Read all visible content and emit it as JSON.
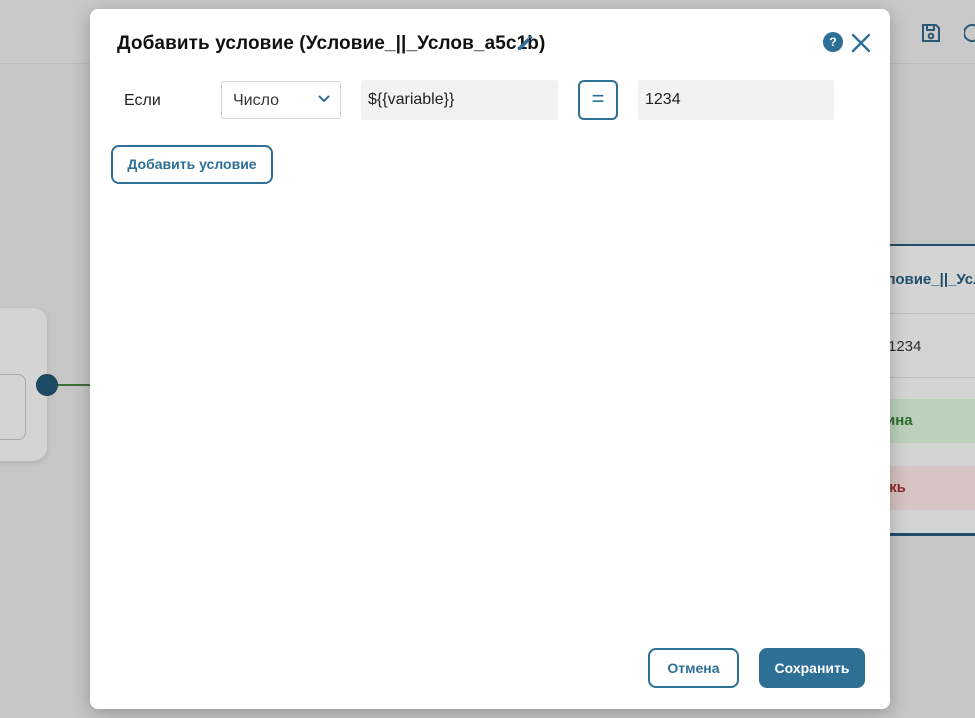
{
  "modal": {
    "title": "Добавить условие (Условие_||_Услов_a5c1b)",
    "help_label": "?",
    "condition": {
      "if_label": "Если",
      "type_value": "Число",
      "variable_value": "${{variable}}",
      "operator": "=",
      "compare_value": "1234"
    },
    "add_condition_label": "Добавить условие",
    "cancel_label": "Отмена",
    "save_label": "Сохранить"
  },
  "background": {
    "card_title": "ловие_||_Услов",
    "card_value": "1234",
    "true_branch": "ина",
    "false_branch": "жь"
  },
  "colors": {
    "accent": "#2e6f96",
    "modal_bg": "#ffffff",
    "field_bg": "#f2f2f2",
    "overlay": "#c7c7c7"
  }
}
